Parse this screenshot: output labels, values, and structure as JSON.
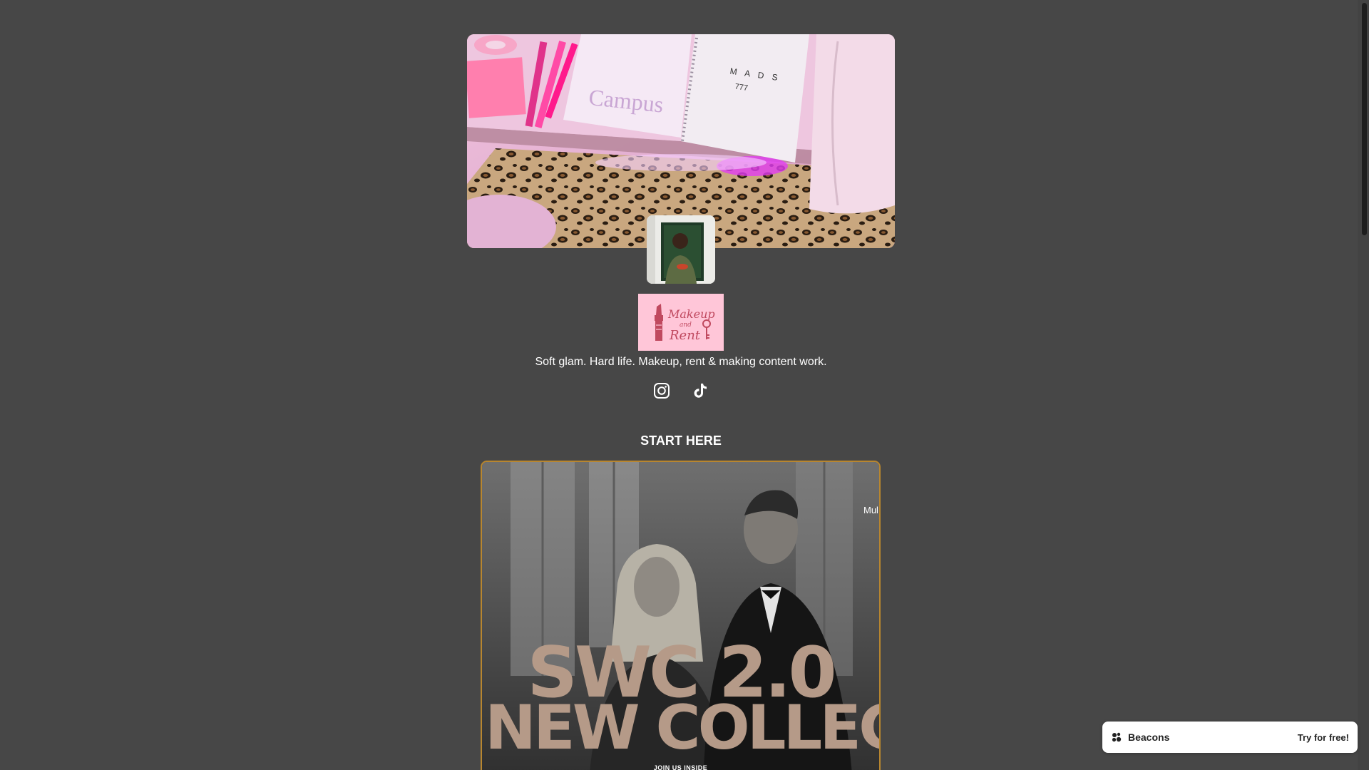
{
  "profile": {
    "bio": "Soft glam. Hard life. Makeup, rent & making content work.",
    "logo_text_line1": "Makeup",
    "logo_text_line2": "and",
    "logo_text_line3": "Rent"
  },
  "banner": {
    "notebook_left_label": "Campus",
    "notebook_right_label": "M A D S",
    "notebook_right_sub": "777"
  },
  "socials": [
    {
      "icon": "instagram-icon"
    },
    {
      "icon": "tiktok-icon"
    }
  ],
  "section": {
    "title": "START HERE"
  },
  "feature": {
    "ticker": "Mul",
    "headline_line1": "SWC 2.0",
    "headline_line2": "NEW COLLECT",
    "subline": "JOIN US INSIDE"
  },
  "badge": {
    "brand": "Beacons",
    "cta": "Try for free!"
  },
  "colors": {
    "background": "#474747",
    "logo_bg": "#ffc6d8",
    "logo_ink": "#c0495f",
    "card_border": "#b8862f",
    "headline": "#b59a88"
  }
}
